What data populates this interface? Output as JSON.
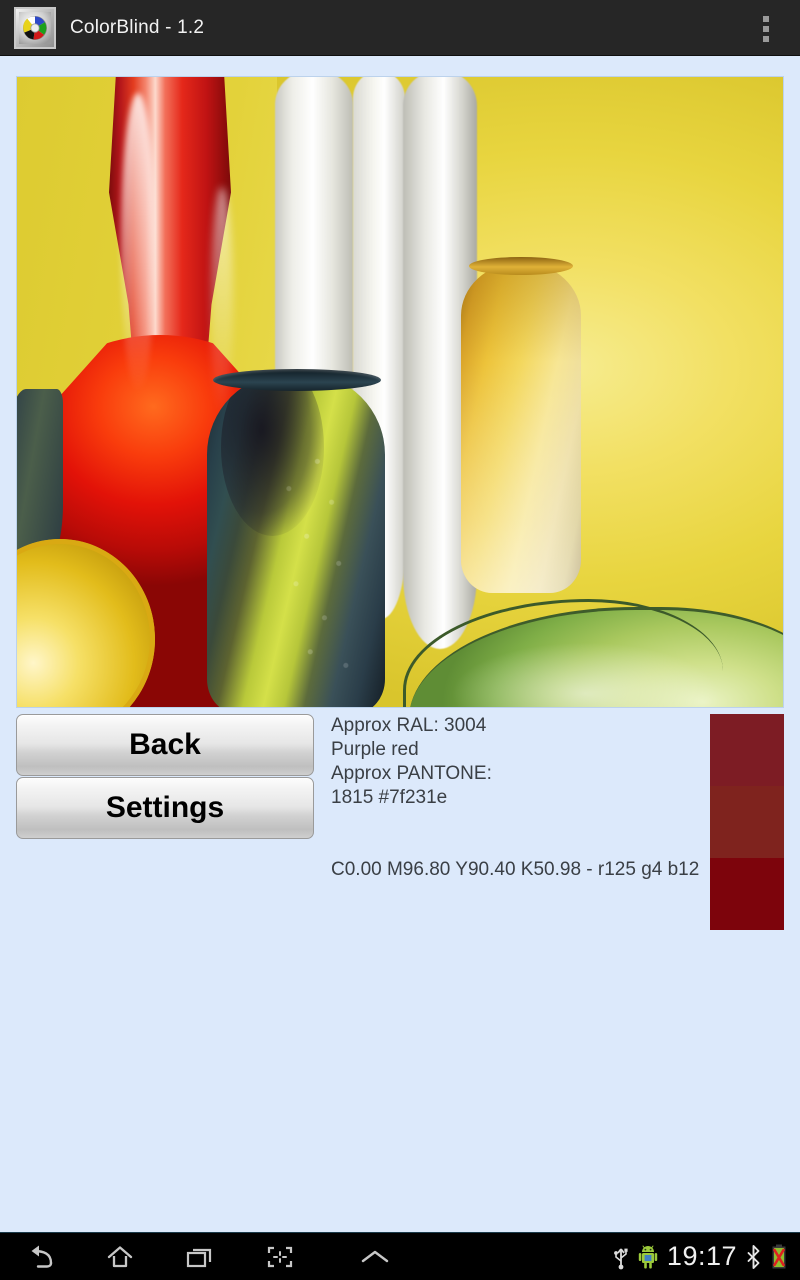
{
  "action_bar": {
    "app_icon": "color-wheel-aperture-icon",
    "title": "ColorBlind - 1.2",
    "overflow_menu": "overflow-menu-icon"
  },
  "photo": {
    "description": "Close-up photograph of colored glass vases against a yellow backdrop",
    "subjects": [
      "red glass decanter",
      "white vases",
      "amber vase",
      "dark teal mottled bottle",
      "green glass bowl",
      "yellow glass sphere"
    ],
    "backdrop_color": "#e8d53f"
  },
  "buttons": {
    "back": "Back",
    "settings": "Settings"
  },
  "color_info": {
    "ral_label": "Approx RAL: 3004",
    "ral_name": "Purple red",
    "pantone_label": "Approx PANTONE:",
    "pantone_value": "1815 #7f231e",
    "cmyk_rgb": "C0.00 M96.80 Y90.40 K50.98 - r125 g4 b12"
  },
  "swatches": [
    {
      "name": "ral-swatch",
      "hex": "#7d1c24"
    },
    {
      "name": "pantone-swatch",
      "hex": "#7f231e"
    },
    {
      "name": "sampled-swatch",
      "hex": "#7d040c"
    }
  ],
  "nav_bar": {
    "back": "back-icon",
    "home": "home-icon",
    "recents": "recents-icon",
    "screenshot": "screenshot-icon",
    "expand": "chevron-up-icon",
    "status": {
      "usb": "usb-icon",
      "android": "android-robot-icon",
      "clock": "19:17",
      "bluetooth": "bluetooth-icon",
      "battery": "battery-error-icon"
    }
  }
}
